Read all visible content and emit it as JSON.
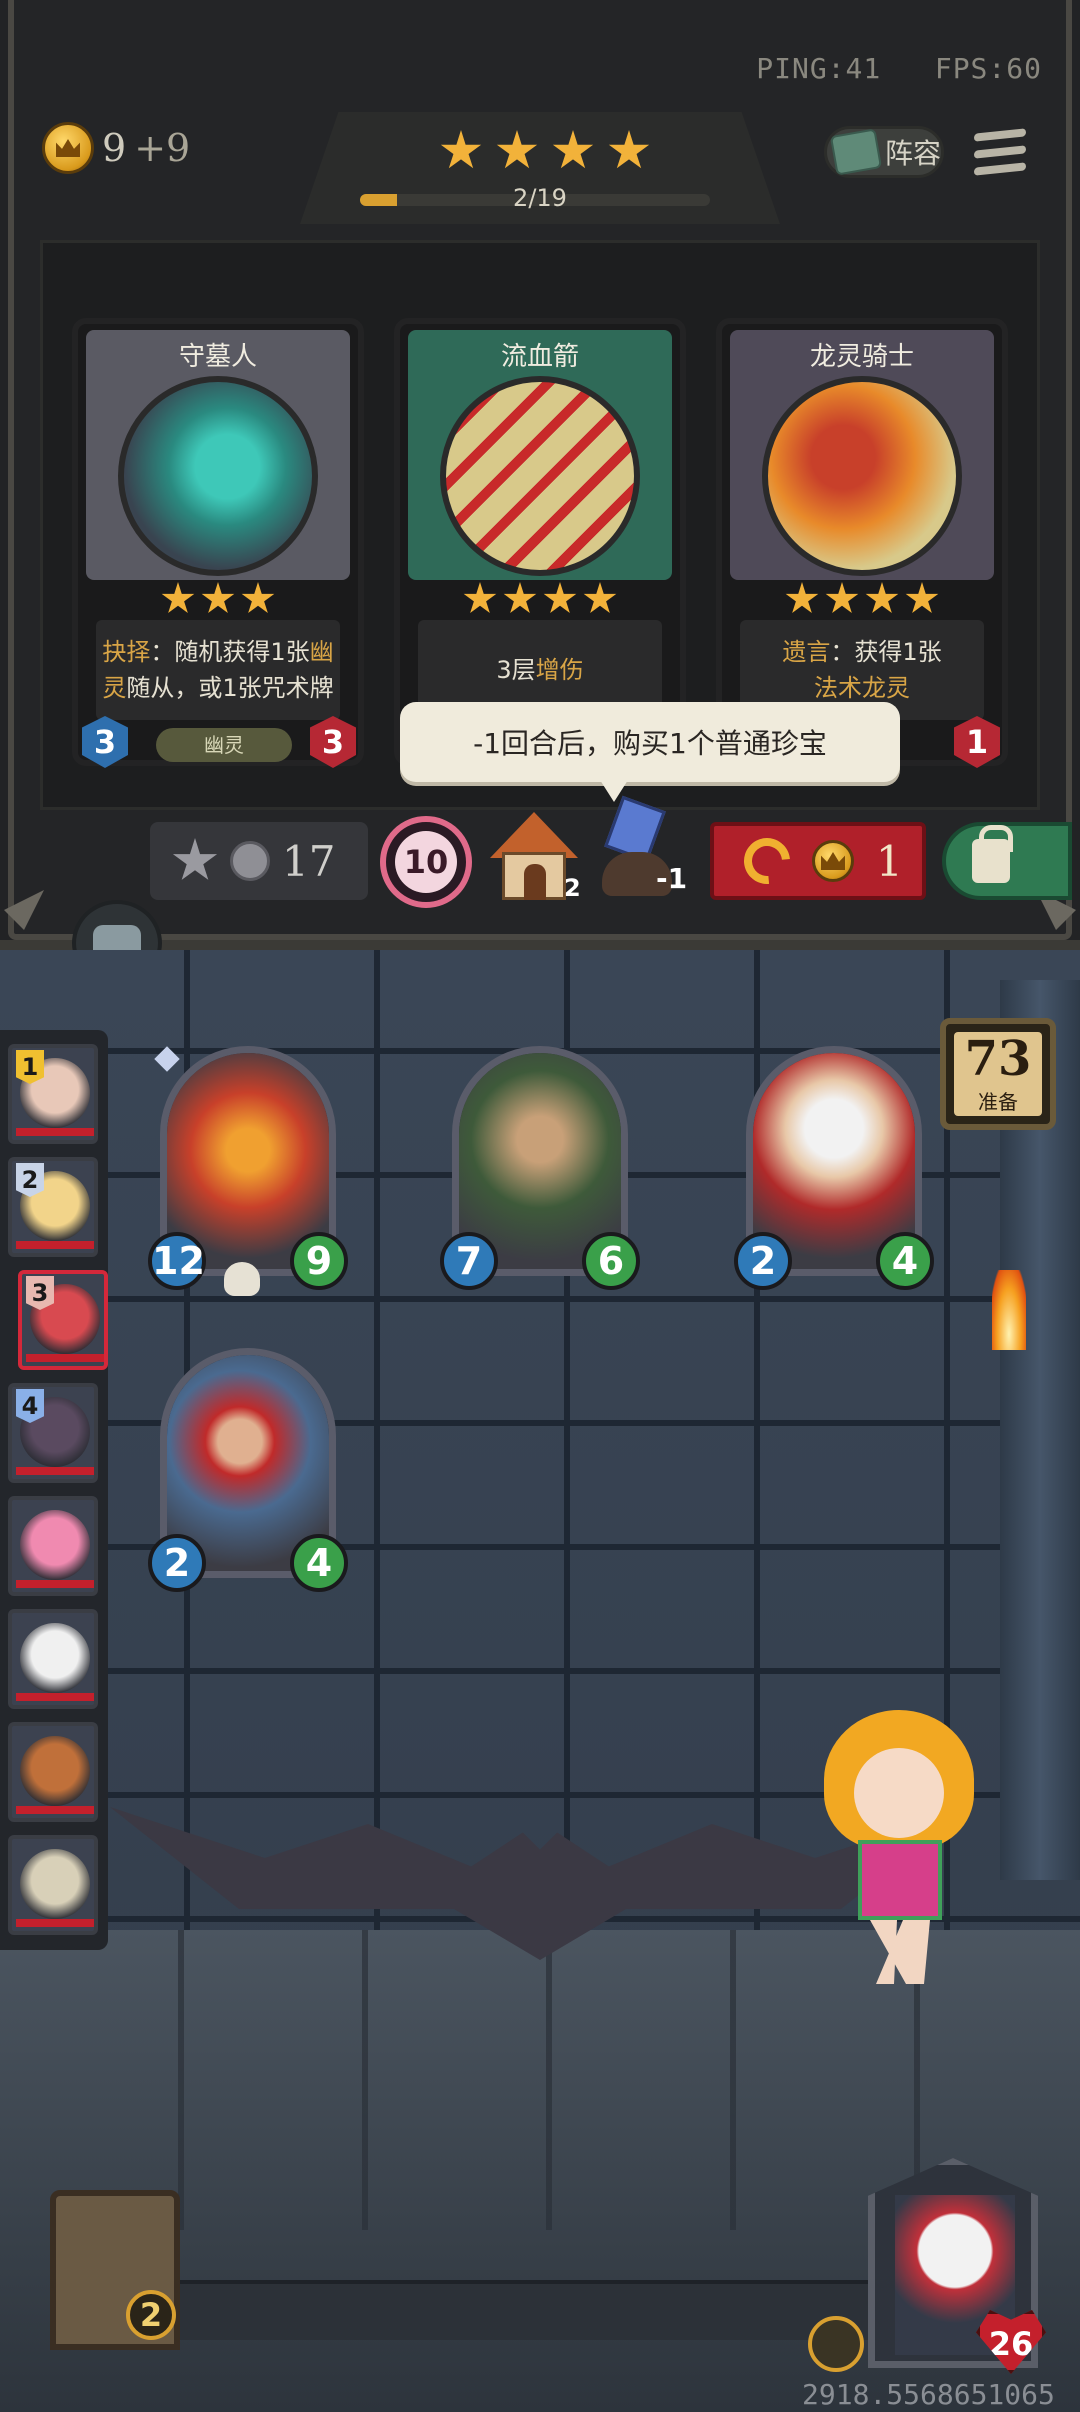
{
  "hud": {
    "ping": "PING:41",
    "fps": "FPS:60"
  },
  "gold": {
    "amount": "9",
    "income": "+9"
  },
  "lineup_label": "阵容",
  "tavern": {
    "stars": 4,
    "xp_text": "2/19",
    "xp_progress": 0.105
  },
  "shop_cards": [
    {
      "name": "守墓人",
      "stars": 3,
      "desc_line1_hl": "抉择",
      "desc_line1": "：随机获得1张",
      "desc_line1_hl2": "幽",
      "desc_line2_hl": "灵",
      "desc_line2": "随从，或1张咒术牌",
      "attack": "3",
      "health": "3",
      "tribe": "幽灵",
      "top_color": "#5a5a63"
    },
    {
      "name": "流血箭",
      "stars": 4,
      "desc_pre": "3层",
      "desc_hl": "增伤",
      "top_color": "#2f6a58"
    },
    {
      "name": "龙灵骑士",
      "stars": 4,
      "desc_line1_hl": "遗言",
      "desc_line1": "：获得1张",
      "desc_line2_hl": "法术龙灵",
      "health": "1",
      "top_color": "#4f4a58"
    }
  ],
  "tooltip": "-1回合后，购买1个普通珍宝",
  "actions": {
    "upgrade_cost": "17",
    "turn": "10",
    "house_count": "2",
    "gem_count": "-1",
    "refresh_cost": "1"
  },
  "roster": [
    {
      "rank": "1",
      "rank_color": "#f0c030",
      "face": "#e8c8b8"
    },
    {
      "rank": "2",
      "rank_color": "#c8d4e8",
      "face": "#f2d48a"
    },
    {
      "rank": "3",
      "rank_color": "#e8b8b0",
      "face": "#d84a50",
      "active": true
    },
    {
      "rank": "4",
      "rank_color": "#8ab0e8",
      "face": "#5a4a60"
    },
    {
      "rank": "",
      "face": "#f08ab0"
    },
    {
      "rank": "",
      "face": "#f0f0f0"
    },
    {
      "rank": "",
      "face": "#c0703a"
    },
    {
      "rank": "",
      "face": "#d8d0b8"
    }
  ],
  "board": [
    {
      "name": "fire-dragon",
      "attack": "12",
      "health": "9",
      "art": "#b83a22",
      "skull": true,
      "diamond": true
    },
    {
      "name": "horn-musketeer",
      "attack": "7",
      "health": "6",
      "art": "#3e5a3a"
    },
    {
      "name": "chef",
      "attack": "2",
      "health": "4",
      "art": "#c8b8a8"
    },
    {
      "name": "pirate-lookout",
      "attack": "2",
      "health": "4",
      "art": "#4a6a90"
    }
  ],
  "timer": {
    "seconds": "73",
    "label": "准备"
  },
  "hand_count": "2",
  "hero_health": "26",
  "footer_id": "2918.5568651065"
}
